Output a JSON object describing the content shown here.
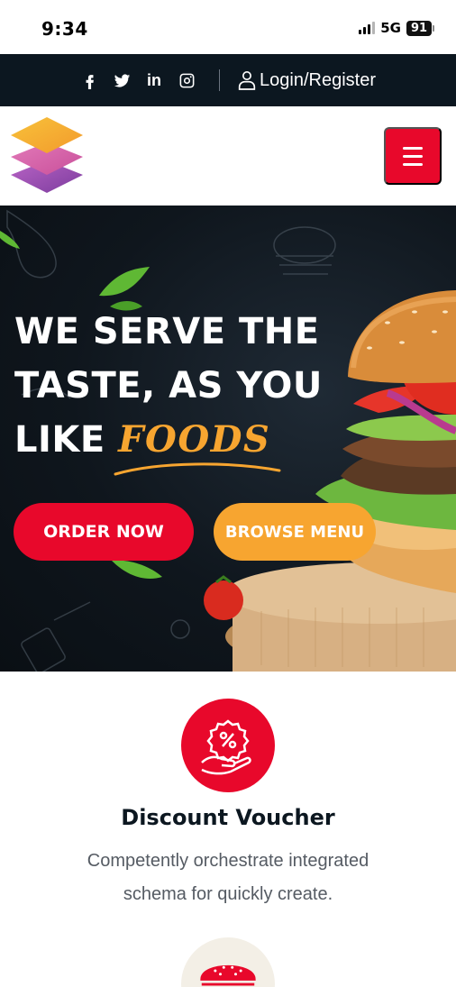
{
  "status_bar": {
    "time": "9:34",
    "network": "5G",
    "battery": "91"
  },
  "top_bar": {
    "social_icons": [
      "facebook-icon",
      "twitter-icon",
      "linkedin-icon",
      "instagram-icon"
    ],
    "linkedin_text": "in",
    "login_label": "Login/Register"
  },
  "header": {
    "logo_icon": "layers-logo",
    "menu_icon": "hamburger-icon"
  },
  "hero": {
    "title_line1": "WE SERVE THE",
    "title_line2": "TASTE, AS YOU",
    "title_line3_prefix": "LIKE",
    "title_accent": "FOODS",
    "order_button": "ORDER NOW",
    "browse_button": "BROWSE MENU"
  },
  "feature": {
    "icon": "discount-hand-icon",
    "title": "Discount Voucher",
    "description": "Competently orchestrate integrated schema for quickly create.",
    "next_icon": "burger-icon"
  },
  "colors": {
    "primary_red": "#e8082b",
    "accent_orange": "#f7a530",
    "dark_navy": "#0c1720",
    "text_gray": "#555b63"
  }
}
